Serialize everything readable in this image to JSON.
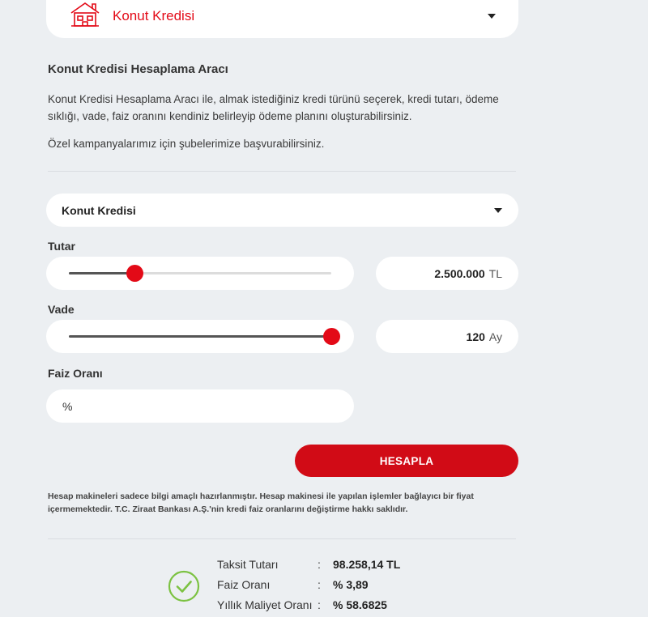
{
  "colors": {
    "brand_red": "#e30a17",
    "button_red": "#d10b16",
    "background": "#eceff2",
    "success_green": "#7cc242"
  },
  "credit_type_select": {
    "icon": "house-icon",
    "label": "Konut Kredisi"
  },
  "intro": {
    "title": "Konut Kredisi Hesaplama Aracı",
    "text": "Konut Kredisi Hesaplama Aracı ile, almak istediğiniz kredi türünü seçerek, kredi tutarı, ödeme sıklığı, vade, faiz oranını kendiniz belirleyip ödeme planını oluşturabilirsiniz.",
    "note": "Özel kampanyalarımız için şubelerimize başvurabilirsiniz."
  },
  "form": {
    "product_select": {
      "value": "Konut Kredisi"
    },
    "amount": {
      "label": "Tutar",
      "value": "2.500.000",
      "unit": "TL",
      "slider_fraction": 0.25
    },
    "term": {
      "label": "Vade",
      "value": "120",
      "unit": "Ay",
      "slider_fraction": 1.0
    },
    "rate": {
      "label": "Faiz Oranı",
      "placeholder": "%"
    },
    "calculate_label": "HESAPLA",
    "disclaimer": "Hesap makineleri sadece bilgi amaçlı hazırlanmıştır. Hesap makinesi ile yapılan işlemler bağlayıcı bir fiyat içermemektedir. T.C. Ziraat Bankası A.Ş.'nin kredi faiz oranlarını değiştirme hakkı saklıdır."
  },
  "result": {
    "icon": "check-circle-icon",
    "rows": [
      {
        "label": "Taksit Tutarı",
        "colon": ":",
        "value": "98.258,14 TL"
      },
      {
        "label": "Faiz Oranı",
        "colon": ":",
        "value": "% 3,89"
      },
      {
        "label": "Yıllık Maliyet Oranı",
        "colon": ":",
        "value": "% 58.6825"
      }
    ]
  }
}
